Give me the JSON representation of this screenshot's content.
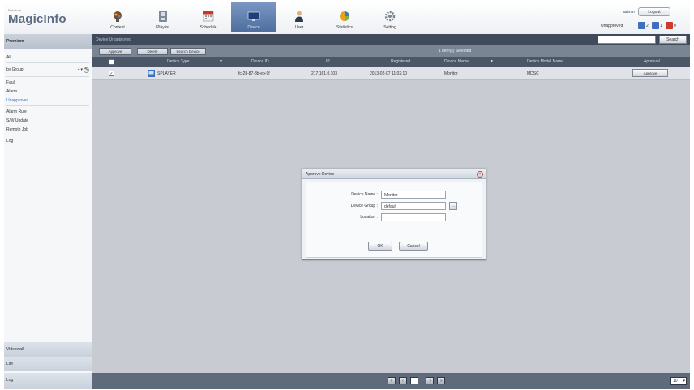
{
  "app": {
    "brand_small": "Premium",
    "brand": "MagicInfo"
  },
  "nav": [
    {
      "label": "Content",
      "icon": "content-icon"
    },
    {
      "label": "Playlist",
      "icon": "playlist-icon"
    },
    {
      "label": "Schedule",
      "icon": "schedule-icon"
    },
    {
      "label": "Device",
      "icon": "device-icon"
    },
    {
      "label": "User",
      "icon": "user-icon"
    },
    {
      "label": "Statistics",
      "icon": "statistics-icon"
    },
    {
      "label": "Setting",
      "icon": "setting-icon"
    }
  ],
  "user": {
    "name": "admin",
    "logout": "Logout",
    "approval_label": "Unapproved",
    "counts": [
      {
        "value": "2",
        "color": "#3c6fc2"
      },
      {
        "value": "1",
        "color": "#3c6fc2"
      },
      {
        "value": "0",
        "color": "#d03a2a"
      }
    ]
  },
  "sidebar": {
    "header": "Premium",
    "items": [
      "All",
      "by Group",
      "Fault",
      "Alarm",
      "Unapproved",
      "Alarm Rule",
      "S/W Update",
      "Remote Job",
      "Log"
    ],
    "bottom": [
      "Videowall",
      "Lite",
      "Log"
    ]
  },
  "main": {
    "breadcrumb": "Device  Unapproved",
    "search_button": "Search",
    "toolbar": {
      "approve": "Approve",
      "delete": "Delete",
      "search_device": "Search Device"
    },
    "selected_text": "1 item(s) Selected",
    "columns": [
      "Device Type",
      "Device ID",
      "IP",
      "Registered",
      "Device Name",
      "Device Model Name",
      "Approval"
    ],
    "rows": [
      {
        "checked": "✓",
        "device_type": "SPLAYER",
        "device_id": "fc-28-87-8b-eb-9f",
        "ip": "217.161.0.103",
        "registered": "2013-02-07 11:02:10",
        "device_name": "Monitor",
        "model": "MDSC",
        "approval": "Approve"
      }
    ],
    "page_size": "10"
  },
  "dialog": {
    "title": "Approve Device",
    "fields": [
      {
        "label": "Device Name :",
        "value": "Monitor"
      },
      {
        "label": "Device Group :",
        "value": "default"
      },
      {
        "label": "Location :",
        "value": ""
      }
    ],
    "ok": "OK",
    "cancel": "Cancel"
  }
}
